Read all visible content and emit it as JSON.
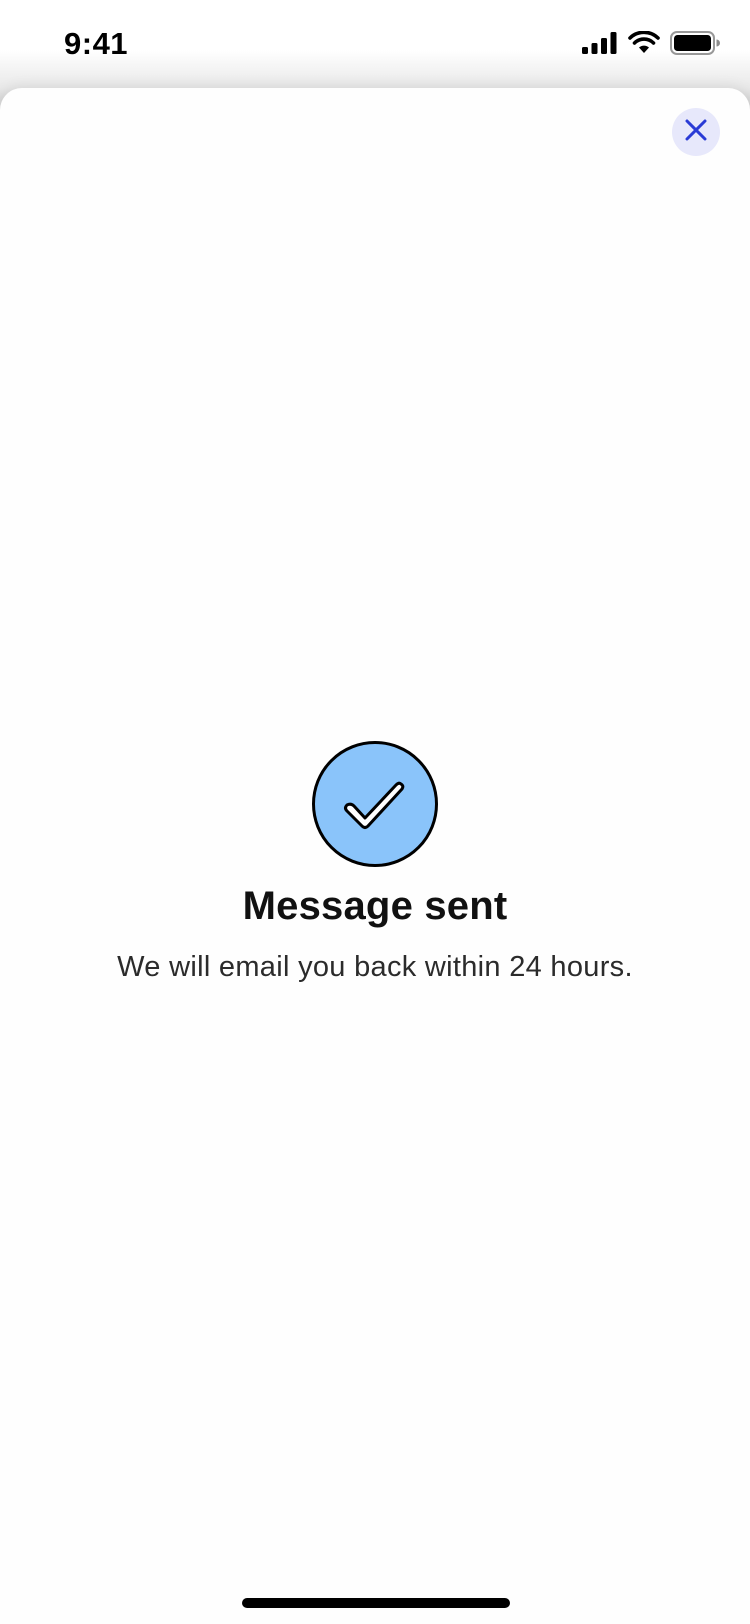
{
  "status_bar": {
    "time": "9:41",
    "signal_icon": "cellular-signal-icon",
    "wifi_icon": "wifi-icon",
    "battery_icon": "battery-icon"
  },
  "close_button": {
    "icon": "close-icon",
    "icon_color": "#2a3bd6",
    "background": "#e7e8fb"
  },
  "confirmation": {
    "icon": "checkmark-circle-icon",
    "icon_fill": "#8ac4fa",
    "title": "Message sent",
    "message": "We will email you back within 24 hours."
  }
}
